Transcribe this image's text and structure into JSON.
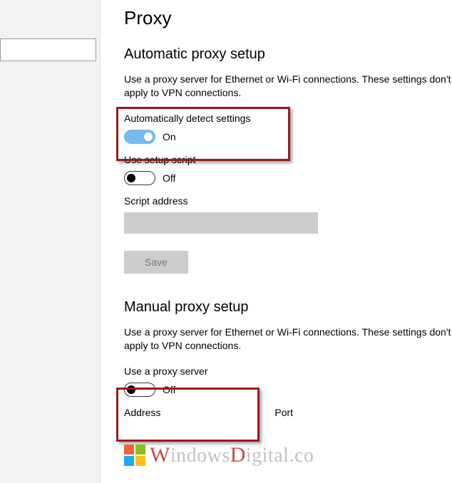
{
  "sidebar": {
    "search_placeholder": ""
  },
  "page": {
    "title": "Proxy"
  },
  "auto": {
    "heading": "Automatic proxy setup",
    "desc": "Use a proxy server for Ethernet or Wi-Fi connections. These settings don't apply to VPN connections.",
    "detect_label": "Automatically detect settings",
    "detect_state": "On",
    "script_label": "Use setup script",
    "script_state": "Off",
    "script_address_label": "Script address",
    "script_address_value": "",
    "save_label": "Save"
  },
  "manual": {
    "heading": "Manual proxy setup",
    "desc": "Use a proxy server for Ethernet or Wi-Fi connections. These settings don't apply to VPN connections.",
    "proxy_label": "Use a proxy server",
    "proxy_state": "Off",
    "address_label": "Address",
    "address_value": "",
    "port_label": "Port",
    "port_value": ""
  },
  "watermark": {
    "text_pre": "W",
    "text_mid": "indows",
    "text_d": "D",
    "text_rest": "igital.co"
  }
}
